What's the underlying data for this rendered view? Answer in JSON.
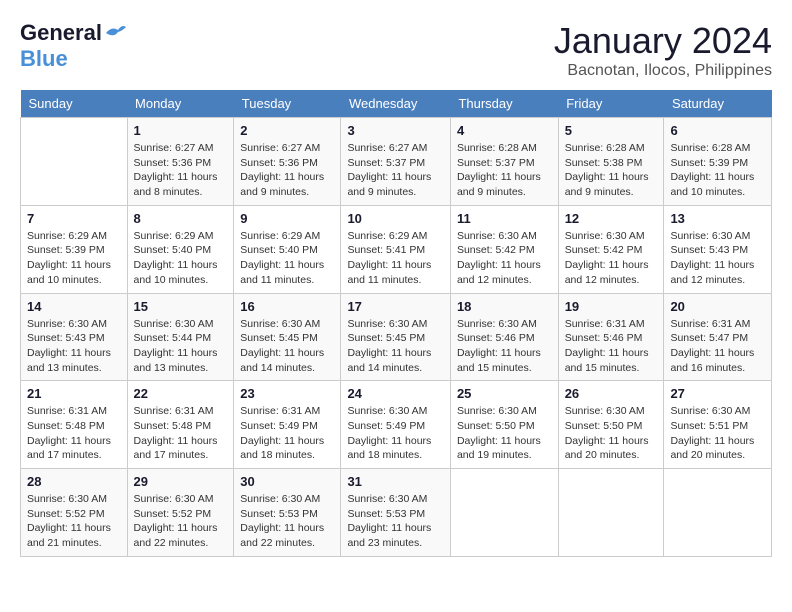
{
  "logo": {
    "general": "General",
    "blue": "Blue"
  },
  "title": "January 2024",
  "location": "Bacnotan, Ilocos, Philippines",
  "weekdays": [
    "Sunday",
    "Monday",
    "Tuesday",
    "Wednesday",
    "Thursday",
    "Friday",
    "Saturday"
  ],
  "weeks": [
    [
      {
        "day": "",
        "sunrise": "",
        "sunset": "",
        "daylight": ""
      },
      {
        "day": "1",
        "sunrise": "Sunrise: 6:27 AM",
        "sunset": "Sunset: 5:36 PM",
        "daylight": "Daylight: 11 hours and 8 minutes."
      },
      {
        "day": "2",
        "sunrise": "Sunrise: 6:27 AM",
        "sunset": "Sunset: 5:36 PM",
        "daylight": "Daylight: 11 hours and 9 minutes."
      },
      {
        "day": "3",
        "sunrise": "Sunrise: 6:27 AM",
        "sunset": "Sunset: 5:37 PM",
        "daylight": "Daylight: 11 hours and 9 minutes."
      },
      {
        "day": "4",
        "sunrise": "Sunrise: 6:28 AM",
        "sunset": "Sunset: 5:37 PM",
        "daylight": "Daylight: 11 hours and 9 minutes."
      },
      {
        "day": "5",
        "sunrise": "Sunrise: 6:28 AM",
        "sunset": "Sunset: 5:38 PM",
        "daylight": "Daylight: 11 hours and 9 minutes."
      },
      {
        "day": "6",
        "sunrise": "Sunrise: 6:28 AM",
        "sunset": "Sunset: 5:39 PM",
        "daylight": "Daylight: 11 hours and 10 minutes."
      }
    ],
    [
      {
        "day": "7",
        "sunrise": "Sunrise: 6:29 AM",
        "sunset": "Sunset: 5:39 PM",
        "daylight": "Daylight: 11 hours and 10 minutes."
      },
      {
        "day": "8",
        "sunrise": "Sunrise: 6:29 AM",
        "sunset": "Sunset: 5:40 PM",
        "daylight": "Daylight: 11 hours and 10 minutes."
      },
      {
        "day": "9",
        "sunrise": "Sunrise: 6:29 AM",
        "sunset": "Sunset: 5:40 PM",
        "daylight": "Daylight: 11 hours and 11 minutes."
      },
      {
        "day": "10",
        "sunrise": "Sunrise: 6:29 AM",
        "sunset": "Sunset: 5:41 PM",
        "daylight": "Daylight: 11 hours and 11 minutes."
      },
      {
        "day": "11",
        "sunrise": "Sunrise: 6:30 AM",
        "sunset": "Sunset: 5:42 PM",
        "daylight": "Daylight: 11 hours and 12 minutes."
      },
      {
        "day": "12",
        "sunrise": "Sunrise: 6:30 AM",
        "sunset": "Sunset: 5:42 PM",
        "daylight": "Daylight: 11 hours and 12 minutes."
      },
      {
        "day": "13",
        "sunrise": "Sunrise: 6:30 AM",
        "sunset": "Sunset: 5:43 PM",
        "daylight": "Daylight: 11 hours and 12 minutes."
      }
    ],
    [
      {
        "day": "14",
        "sunrise": "Sunrise: 6:30 AM",
        "sunset": "Sunset: 5:43 PM",
        "daylight": "Daylight: 11 hours and 13 minutes."
      },
      {
        "day": "15",
        "sunrise": "Sunrise: 6:30 AM",
        "sunset": "Sunset: 5:44 PM",
        "daylight": "Daylight: 11 hours and 13 minutes."
      },
      {
        "day": "16",
        "sunrise": "Sunrise: 6:30 AM",
        "sunset": "Sunset: 5:45 PM",
        "daylight": "Daylight: 11 hours and 14 minutes."
      },
      {
        "day": "17",
        "sunrise": "Sunrise: 6:30 AM",
        "sunset": "Sunset: 5:45 PM",
        "daylight": "Daylight: 11 hours and 14 minutes."
      },
      {
        "day": "18",
        "sunrise": "Sunrise: 6:30 AM",
        "sunset": "Sunset: 5:46 PM",
        "daylight": "Daylight: 11 hours and 15 minutes."
      },
      {
        "day": "19",
        "sunrise": "Sunrise: 6:31 AM",
        "sunset": "Sunset: 5:46 PM",
        "daylight": "Daylight: 11 hours and 15 minutes."
      },
      {
        "day": "20",
        "sunrise": "Sunrise: 6:31 AM",
        "sunset": "Sunset: 5:47 PM",
        "daylight": "Daylight: 11 hours and 16 minutes."
      }
    ],
    [
      {
        "day": "21",
        "sunrise": "Sunrise: 6:31 AM",
        "sunset": "Sunset: 5:48 PM",
        "daylight": "Daylight: 11 hours and 17 minutes."
      },
      {
        "day": "22",
        "sunrise": "Sunrise: 6:31 AM",
        "sunset": "Sunset: 5:48 PM",
        "daylight": "Daylight: 11 hours and 17 minutes."
      },
      {
        "day": "23",
        "sunrise": "Sunrise: 6:31 AM",
        "sunset": "Sunset: 5:49 PM",
        "daylight": "Daylight: 11 hours and 18 minutes."
      },
      {
        "day": "24",
        "sunrise": "Sunrise: 6:30 AM",
        "sunset": "Sunset: 5:49 PM",
        "daylight": "Daylight: 11 hours and 18 minutes."
      },
      {
        "day": "25",
        "sunrise": "Sunrise: 6:30 AM",
        "sunset": "Sunset: 5:50 PM",
        "daylight": "Daylight: 11 hours and 19 minutes."
      },
      {
        "day": "26",
        "sunrise": "Sunrise: 6:30 AM",
        "sunset": "Sunset: 5:50 PM",
        "daylight": "Daylight: 11 hours and 20 minutes."
      },
      {
        "day": "27",
        "sunrise": "Sunrise: 6:30 AM",
        "sunset": "Sunset: 5:51 PM",
        "daylight": "Daylight: 11 hours and 20 minutes."
      }
    ],
    [
      {
        "day": "28",
        "sunrise": "Sunrise: 6:30 AM",
        "sunset": "Sunset: 5:52 PM",
        "daylight": "Daylight: 11 hours and 21 minutes."
      },
      {
        "day": "29",
        "sunrise": "Sunrise: 6:30 AM",
        "sunset": "Sunset: 5:52 PM",
        "daylight": "Daylight: 11 hours and 22 minutes."
      },
      {
        "day": "30",
        "sunrise": "Sunrise: 6:30 AM",
        "sunset": "Sunset: 5:53 PM",
        "daylight": "Daylight: 11 hours and 22 minutes."
      },
      {
        "day": "31",
        "sunrise": "Sunrise: 6:30 AM",
        "sunset": "Sunset: 5:53 PM",
        "daylight": "Daylight: 11 hours and 23 minutes."
      },
      {
        "day": "",
        "sunrise": "",
        "sunset": "",
        "daylight": ""
      },
      {
        "day": "",
        "sunrise": "",
        "sunset": "",
        "daylight": ""
      },
      {
        "day": "",
        "sunrise": "",
        "sunset": "",
        "daylight": ""
      }
    ]
  ]
}
